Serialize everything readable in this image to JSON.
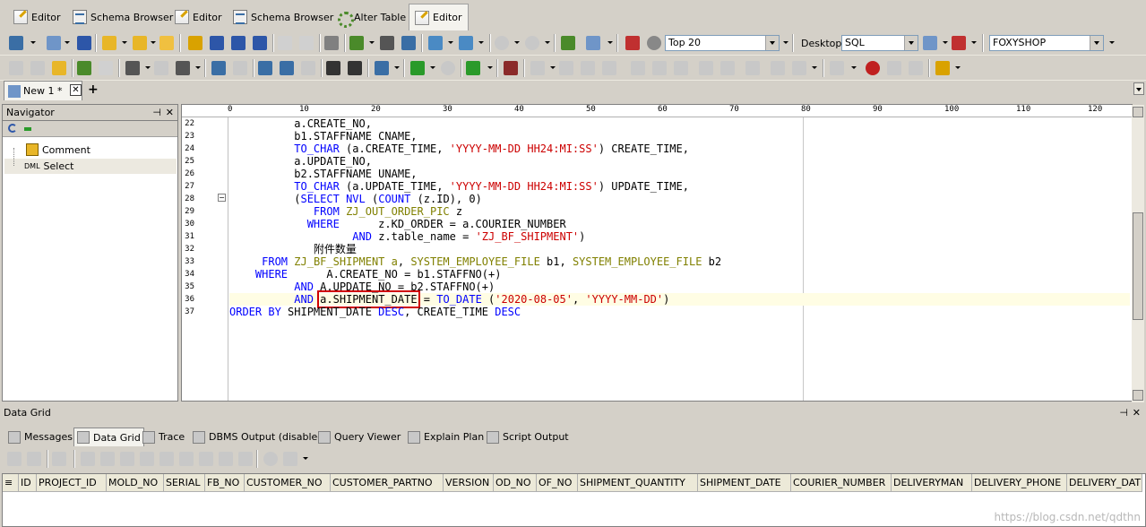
{
  "window_tabs": [
    {
      "label": "Editor",
      "icon": "editor-icon",
      "active": false
    },
    {
      "label": "Schema Browser",
      "icon": "schema-browser-icon",
      "active": false
    },
    {
      "label": "Editor",
      "icon": "editor-icon",
      "active": false
    },
    {
      "label": "Schema Browser",
      "icon": "schema-browser-icon",
      "active": false
    },
    {
      "label": "Alter Table",
      "icon": "alter-table-icon",
      "active": false
    },
    {
      "label": "Editor",
      "icon": "editor-icon",
      "active": true
    }
  ],
  "toolbar": {
    "top_label": "Top 20",
    "desktop_label": "Desktop:",
    "desktop_value": "SQL",
    "connection_value": "FOXYSHOP"
  },
  "doc_tab": {
    "label": "New 1 *",
    "add": "+"
  },
  "navigator": {
    "title": "Navigator",
    "pin": "⊣",
    "close": "✕",
    "items": [
      {
        "label": "Comment",
        "icon": "comment-icon"
      },
      {
        "label": "Select",
        "prefix": "DML",
        "icon": "dml-select-icon"
      }
    ]
  },
  "ruler_ticks": [
    "0",
    "10",
    "20",
    "30",
    "40",
    "50",
    "60",
    "70",
    "80",
    "90",
    "100",
    "110",
    "120"
  ],
  "code": [
    {
      "n": "22",
      "text": "          a.CREATE_NO,"
    },
    {
      "n": "23",
      "text": "          b1.STAFFNAME CNAME,"
    },
    {
      "n": "24",
      "text": "          TO_CHAR (a.CREATE_TIME, 'YYYY-MM-DD HH24:MI:SS') CREATE_TIME,"
    },
    {
      "n": "25",
      "text": "          a.UPDATE_NO,"
    },
    {
      "n": "26",
      "text": "          b2.STAFFNAME UNAME,"
    },
    {
      "n": "27",
      "text": "          TO_CHAR (a.UPDATE_TIME, 'YYYY-MM-DD HH24:MI:SS') UPDATE_TIME,"
    },
    {
      "n": "28",
      "text": "          (SELECT NVL (COUNT (z.ID), 0)"
    },
    {
      "n": "29",
      "text": "             FROM ZJ_OUT_ORDER_PIC z"
    },
    {
      "n": "30",
      "text": "            WHERE      z.KD_ORDER = a.COURIER_NUMBER"
    },
    {
      "n": "31",
      "text": "                   AND z.table_name = 'ZJ_BF_SHIPMENT')"
    },
    {
      "n": "32",
      "text": "             附件数量"
    },
    {
      "n": "33",
      "text": "     FROM ZJ_BF_SHIPMENT a, SYSTEM_EMPLOYEE_FILE b1, SYSTEM_EMPLOYEE_FILE b2"
    },
    {
      "n": "34",
      "text": "    WHERE      A.CREATE_NO = b1.STAFFNO(+)"
    },
    {
      "n": "35",
      "text": "          AND A.UPDATE_NO = b2.STAFFNO(+)"
    },
    {
      "n": "36",
      "text": "          AND a.SHIPMENT_DATE = TO_DATE ('2020-08-05', 'YYYY-MM-DD')"
    },
    {
      "n": "37",
      "text": "ORDER BY SHIPMENT_DATE DESC, CREATE_TIME DESC"
    }
  ],
  "data_grid": {
    "title": "Data Grid",
    "tabs": [
      {
        "label": "Messages",
        "active": false
      },
      {
        "label": "Data Grid",
        "active": true
      },
      {
        "label": "Trace",
        "active": false
      },
      {
        "label": "DBMS Output (disabled)",
        "active": false
      },
      {
        "label": "Query Viewer",
        "active": false
      },
      {
        "label": "Explain Plan",
        "active": false
      },
      {
        "label": "Script Output",
        "active": false
      }
    ],
    "columns": [
      "ID",
      "PROJECT_ID",
      "MOLD_NO",
      "SERIAL",
      "FB_NO",
      "CUSTOMER_NO",
      "CUSTOMER_PARTNO",
      "VERSION",
      "OD_NO",
      "OF_NO",
      "SHIPMENT_QUANTITY",
      "SHIPMENT_DATE",
      "COURIER_NUMBER",
      "DELIVERYMAN",
      "DELIVERY_PHONE",
      "DELIVERY_DAT"
    ]
  },
  "watermark": "https://blog.csdn.net/qdthn",
  "colors": {
    "keyword": "#0000ff",
    "table": "#808000",
    "string": "#cc0000",
    "highlight_box": "#d00000"
  }
}
